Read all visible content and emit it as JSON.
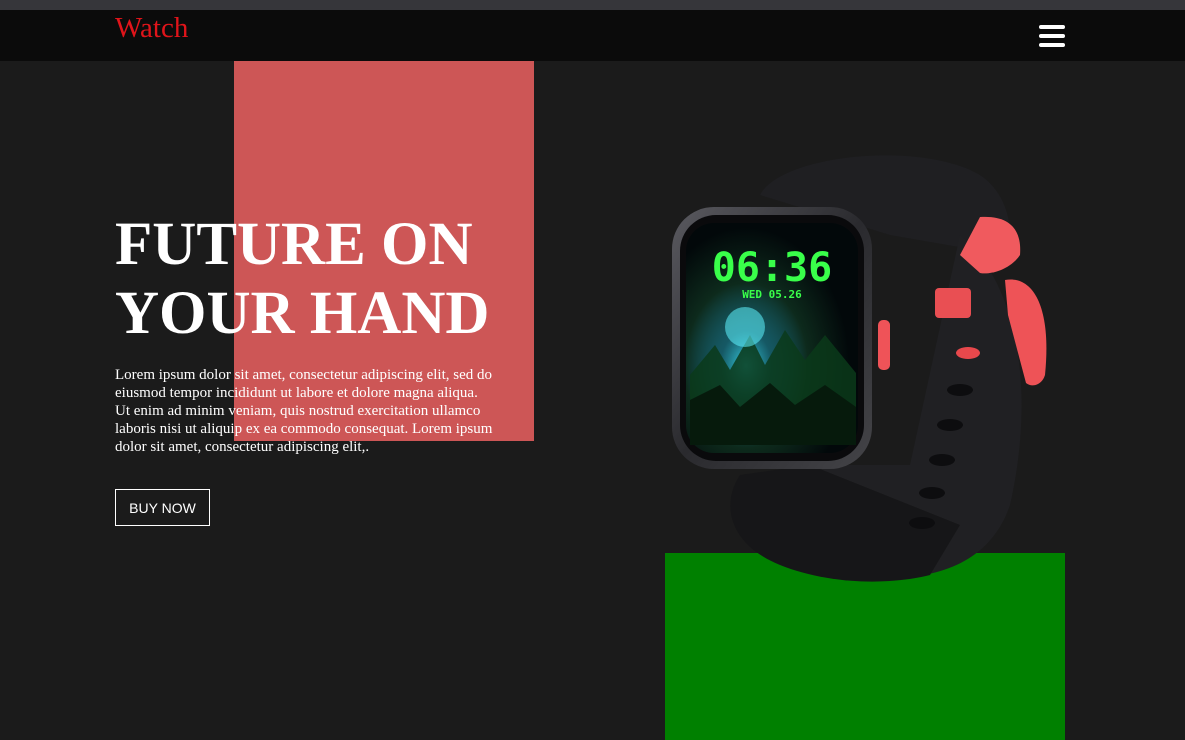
{
  "navbar": {
    "brand": "Watch",
    "menu_icon": "hamburger-menu-icon"
  },
  "hero": {
    "title_line1": "FUTURE ON",
    "title_line2": "YOUR HAND",
    "description": "Lorem ipsum dolor sit amet, consectetur adipiscing elit, sed do eiusmod tempor incididunt ut labore et dolore magna aliqua. Ut enim ad minim veniam, quis nostrud exercitation ullamco laboris nisi ut aliquip ex ea commodo consequat. Lorem ipsum dolor sit amet, consectetur adipiscing elit,.",
    "button_label": "BUY NOW"
  },
  "watch": {
    "time": "06:36",
    "date": "WED 05.26"
  },
  "colors": {
    "brand": "#e0141a",
    "red_block": "#cd5656",
    "green_block": "#008000",
    "background": "#1b1b1b",
    "navbar": "#0b0b0b",
    "watch_display": "#39ff4a",
    "strap_accent": "#f05a5e"
  }
}
